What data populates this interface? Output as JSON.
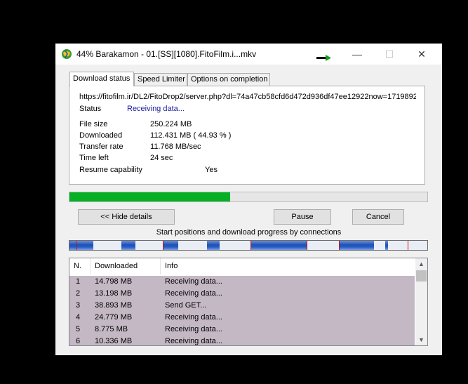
{
  "window": {
    "title": "44% Barakamon - 01.[SS][1080].FitoFilm.i...mkv",
    "minimize": "—",
    "maximize": "☐",
    "close": "✕"
  },
  "tabs": [
    "Download status",
    "Speed Limiter",
    "Options on completion"
  ],
  "info": {
    "url": "https://fitofilm.ir/DL2/FitoDrop2/server.php?dl=74a47cb58cfd6d472d936df47ee12922now=1719892",
    "status_label": "Status",
    "status_value": "Receiving data...",
    "file_size_label": "File size",
    "file_size_value": "250.224  MB",
    "downloaded_label": "Downloaded",
    "downloaded_value": "112.431  MB  ( 44.93 % )",
    "rate_label": "Transfer rate",
    "rate_value": "11.768  MB/sec",
    "time_left_label": "Time left",
    "time_left_value": "24 sec",
    "resume_label": "Resume capability",
    "resume_value": "Yes"
  },
  "progress": {
    "percent": 44.93
  },
  "buttons": {
    "hide_details": "<< Hide details",
    "pause": "Pause",
    "cancel": "Cancel"
  },
  "connections_caption": "Start positions and download progress by connections",
  "table": {
    "headers": [
      "N.",
      "Downloaded",
      "Info"
    ],
    "rows": [
      [
        "1",
        "14.798  MB",
        "Receiving data..."
      ],
      [
        "2",
        "13.198  MB",
        "Receiving data..."
      ],
      [
        "3",
        "38.893  MB",
        "Send GET..."
      ],
      [
        "4",
        "24.779  MB",
        "Receiving data..."
      ],
      [
        "5",
        "8.775  MB",
        "Receiving data..."
      ],
      [
        "6",
        "10.336  MB",
        "Receiving data..."
      ]
    ]
  },
  "colors": {
    "progress": "#06b025",
    "status_text": "#1a1a9c",
    "row_bg": "#c4b8c4",
    "segment": "#2a5fc8",
    "marker": "#d01010"
  }
}
